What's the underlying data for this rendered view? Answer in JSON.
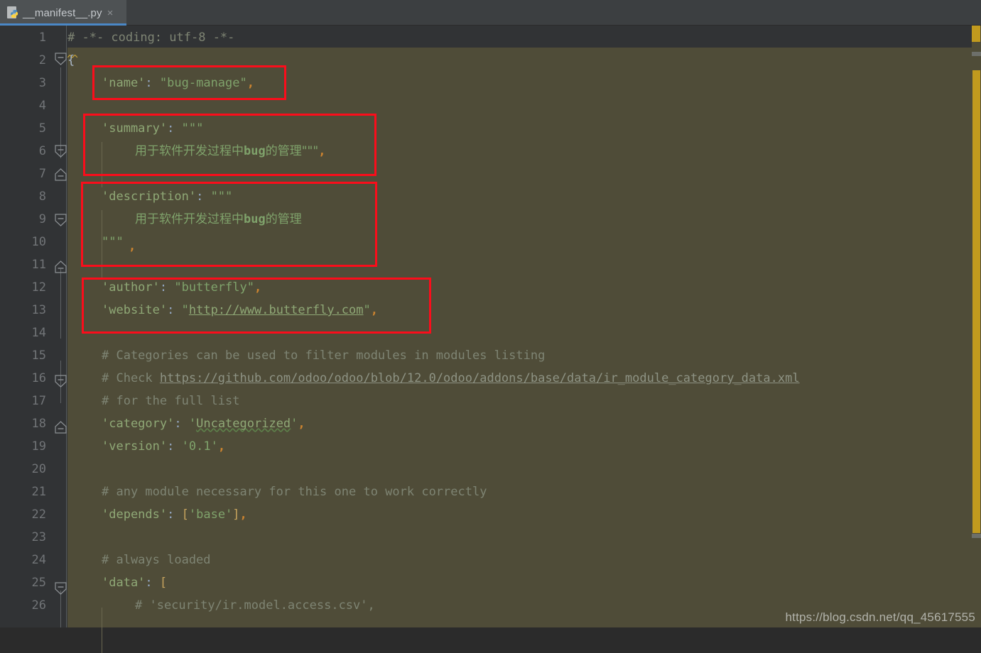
{
  "window": {
    "title": "__manifest__.py"
  },
  "tab": {
    "label": "__manifest__.py",
    "close": "×",
    "icon": "python-file-icon"
  },
  "editor": {
    "language": "Python",
    "colors": {
      "background": "#4f4c38",
      "gutter": "#313335",
      "string": "#7fa26b",
      "comment": "#7e8473",
      "comma": "#cd8430",
      "annotation_box": "#fb0d1b",
      "scrollbar_thumb": "#c19a1e",
      "tab_active_underline": "#4a88c7"
    },
    "line_numbers": [
      1,
      2,
      3,
      4,
      5,
      6,
      7,
      8,
      9,
      10,
      11,
      12,
      13,
      14,
      15,
      16,
      17,
      18,
      19,
      20,
      21,
      22,
      23,
      24,
      25,
      26
    ],
    "lines": [
      {
        "n": 1,
        "text": "# -*- coding: utf-8 -*-"
      },
      {
        "n": 2,
        "text": "{"
      },
      {
        "n": 3,
        "text": "    'name': \"bug-manage\","
      },
      {
        "n": 4,
        "text": ""
      },
      {
        "n": 5,
        "text": "    'summary': \"\"\""
      },
      {
        "n": 6,
        "text": "        用于软件开发过程中bug的管理\"\"\","
      },
      {
        "n": 7,
        "text": ""
      },
      {
        "n": 8,
        "text": "    'description': \"\"\""
      },
      {
        "n": 9,
        "text": "        用于软件开发过程中bug的管理"
      },
      {
        "n": 10,
        "text": "    \"\"\","
      },
      {
        "n": 11,
        "text": ""
      },
      {
        "n": 12,
        "text": "    'author': \"butterfly\","
      },
      {
        "n": 13,
        "text": "    'website': \"http://www.butterfly.com\","
      },
      {
        "n": 14,
        "text": ""
      },
      {
        "n": 15,
        "text": "    # Categories can be used to filter modules in modules listing"
      },
      {
        "n": 16,
        "text": "    # Check https://github.com/odoo/odoo/blob/12.0/odoo/addons/base/data/ir_module_category_data.xml"
      },
      {
        "n": 17,
        "text": "    # for the full list"
      },
      {
        "n": 18,
        "text": "    'category': 'Uncategorized',"
      },
      {
        "n": 19,
        "text": "    'version': '0.1',"
      },
      {
        "n": 20,
        "text": ""
      },
      {
        "n": 21,
        "text": "    # any module necessary for this one to work correctly"
      },
      {
        "n": 22,
        "text": "    'depends': ['base'],"
      },
      {
        "n": 23,
        "text": ""
      },
      {
        "n": 24,
        "text": "    # always loaded"
      },
      {
        "n": 25,
        "text": "    'data': ["
      },
      {
        "n": 26,
        "text": "        # 'security/ir.model.access.csv',"
      }
    ],
    "tokens": {
      "l1_comment": "# -*- coding: utf-8 -*-",
      "l2_brace": "{",
      "l3_key": "'name'",
      "l3_value": "\"bug-manage\"",
      "l5_key": "'summary'",
      "l5_value": "\"\"\"",
      "l6_value": "用于软件开发过程中",
      "l6_bug": "bug",
      "l6_tail": "的管理\"\"\"",
      "l8_key": "'description'",
      "l8_value": "\"\"\"",
      "l9_value": "用于软件开发过程中",
      "l9_bug": "bug",
      "l9_tail": "的管理",
      "l10_value": "\"\"\"",
      "l12_key": "'author'",
      "l12_value": "\"butterfly\"",
      "l13_key": "'website'",
      "l13_quote_open": "\"",
      "l13_url": "http://www.butterfly.com",
      "l13_quote_close": "\"",
      "l15_comment": "# Categories can be used to filter modules in modules listing",
      "l16_comment_head": "# Check ",
      "l16_url": "https://github.com/odoo/odoo/blob/12.0/odoo/addons/base/data/ir_module_category_data.xml",
      "l17_comment": "# for the full list",
      "l18_key": "'category'",
      "l18_value_open": "'",
      "l18_value_word": "Uncategorized",
      "l18_value_close": "'",
      "l19_key": "'version'",
      "l19_value": "'0.1'",
      "l21_comment": "# any module necessary for this one to work correctly",
      "l22_key": "'depends'",
      "l22_open": "[",
      "l22_value": "'base'",
      "l22_close": "]",
      "l24_comment": "# always loaded",
      "l25_key": "'data'",
      "l25_open": "[",
      "l26_comment": "# 'security/ir.model.access.csv',",
      "colon": ":",
      "comma": ","
    }
  },
  "annotations": {
    "boxes": [
      {
        "label": "name-highlight",
        "lines": "3"
      },
      {
        "label": "summary-highlight",
        "lines": "5-6"
      },
      {
        "label": "description-highlight",
        "lines": "8-10"
      },
      {
        "label": "author-website-highlight",
        "lines": "12-13"
      }
    ]
  },
  "watermark": {
    "text": "https://blog.csdn.net/qq_45617555"
  }
}
